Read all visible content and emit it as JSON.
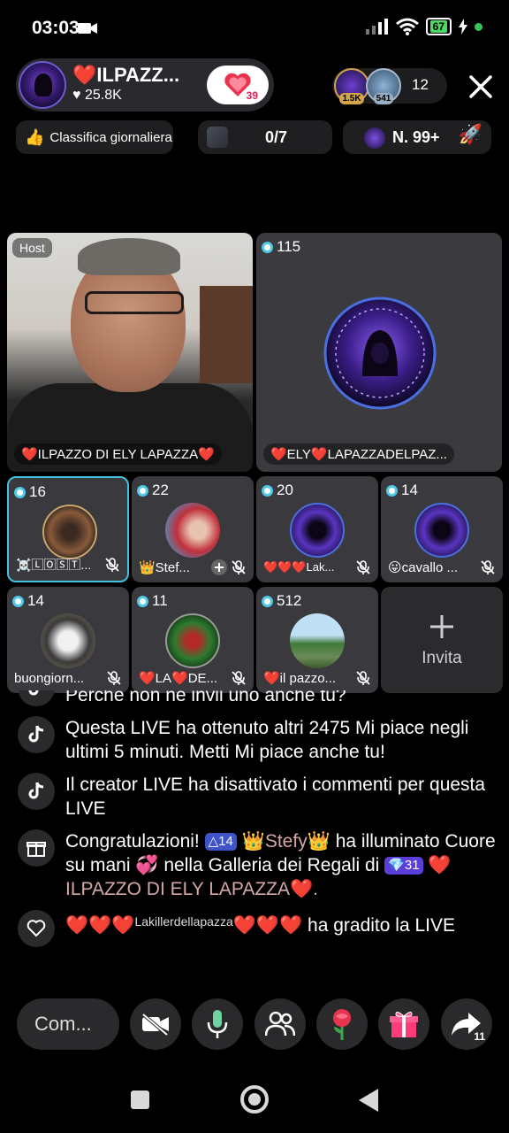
{
  "status_bar": {
    "time": "03:03",
    "battery": "67"
  },
  "host": {
    "name": "❤️ILPAZZ...",
    "likes": "♥ 25.8K",
    "follow_badge": "39"
  },
  "viewers": {
    "avatar1_badge": "1.5K",
    "avatar2_badge": "541",
    "count": "12"
  },
  "rank_row": {
    "daily_label": "Classifica giornaliera",
    "progress": "0/7",
    "rank": "N. 99+"
  },
  "grid": {
    "host_tag": "Host",
    "host_name": "❤️ILPAZZO DI ELY LAPAZZA❤️",
    "big": {
      "count": "115",
      "name": "❤️ELY❤️LAPAZZADELPAZ..."
    },
    "small": [
      {
        "count": "16",
        "name": "☠️🄻🄾🅂🅃..."
      },
      {
        "count": "22",
        "name": "👑Stef..."
      },
      {
        "count": "20",
        "name": "❤️❤️❤️Lak..."
      },
      {
        "count": "14",
        "name": "😛cavallo ..."
      },
      {
        "count": "14",
        "name": "buongiorn..."
      },
      {
        "count": "11",
        "name": "❤️LA❤️DE..."
      },
      {
        "count": "512",
        "name": "❤️il pazzo..."
      }
    ],
    "invite_label": "Invita"
  },
  "chat": {
    "m1": "Perché non ne invii uno anche tu?",
    "m2": "Questa LIVE ha ottenuto altri 2475 Mi piace negli ultimi 5 minuti. Metti Mi piace anche tu!",
    "m3": "Il creator LIVE ha disattivato i commenti per questa LIVE",
    "m4": {
      "prefix": "Congratulazioni!",
      "badge1": "14",
      "user": "👑Stefy👑",
      "mid": "ha illuminato Cuore su mani",
      "mid2": "nella Galleria dei Regali di",
      "badge2": "31",
      "target": "❤️ILPAZZO DI ELY LAPAZZA❤️."
    },
    "m5": {
      "hearts1": "❤️❤️❤️",
      "user": "Lakillerdellapazza",
      "hearts2": "❤️❤️❤️",
      "text": "ha gradito la LIVE"
    }
  },
  "bottom": {
    "comment_placeholder": "Com...",
    "share_count": "11"
  }
}
